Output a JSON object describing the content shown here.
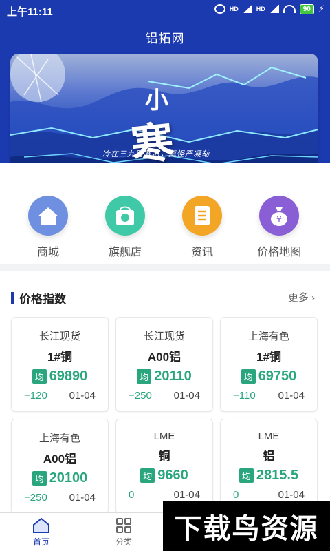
{
  "status": {
    "time": "上午11:11",
    "battery": "90",
    "hd1": "HD",
    "hd2": "HD"
  },
  "app": {
    "title": "铝拓网"
  },
  "banner": {
    "calligraphy_small": "小",
    "calligraphy": "寒",
    "slogan": "冷在三九防寒冻，莫怪严凝劫"
  },
  "quick_links": [
    {
      "label": "商城",
      "icon": "home-icon",
      "color": "#6f8fe0"
    },
    {
      "label": "旗舰店",
      "icon": "shopping-bag-icon",
      "color": "#3fc9a6"
    },
    {
      "label": "资讯",
      "icon": "news-document-icon",
      "color": "#f3a526"
    },
    {
      "label": "价格地图",
      "icon": "money-bag-icon",
      "color": "#8a5fd6"
    }
  ],
  "price_index": {
    "title": "价格指数",
    "more": "更多",
    "avg_label": "均",
    "cards": [
      {
        "source": "长江现货",
        "product": "1#铜",
        "avg": "69890",
        "change": "−120",
        "date": "01-04"
      },
      {
        "source": "长江现货",
        "product": "A00铝",
        "avg": "20110",
        "change": "−250",
        "date": "01-04"
      },
      {
        "source": "上海有色",
        "product": "1#铜",
        "avg": "69750",
        "change": "−110",
        "date": "01-04"
      },
      {
        "source": "上海有色",
        "product": "A00铝",
        "avg": "20100",
        "change": "−250",
        "date": "01-04"
      },
      {
        "source": "LME",
        "product": "铜",
        "avg": "9660",
        "change": "0",
        "date": "01-04"
      },
      {
        "source": "LME",
        "product": "铝",
        "avg": "2815.5",
        "change": "0",
        "date": "01-04"
      }
    ]
  },
  "tabs": [
    {
      "label": "首页",
      "icon": "home-icon"
    },
    {
      "label": "分类",
      "icon": "grid-icon"
    }
  ],
  "watermark": "下载鸟资源",
  "colors": {
    "brand": "#1c3ab0",
    "green": "#2aa67e"
  }
}
